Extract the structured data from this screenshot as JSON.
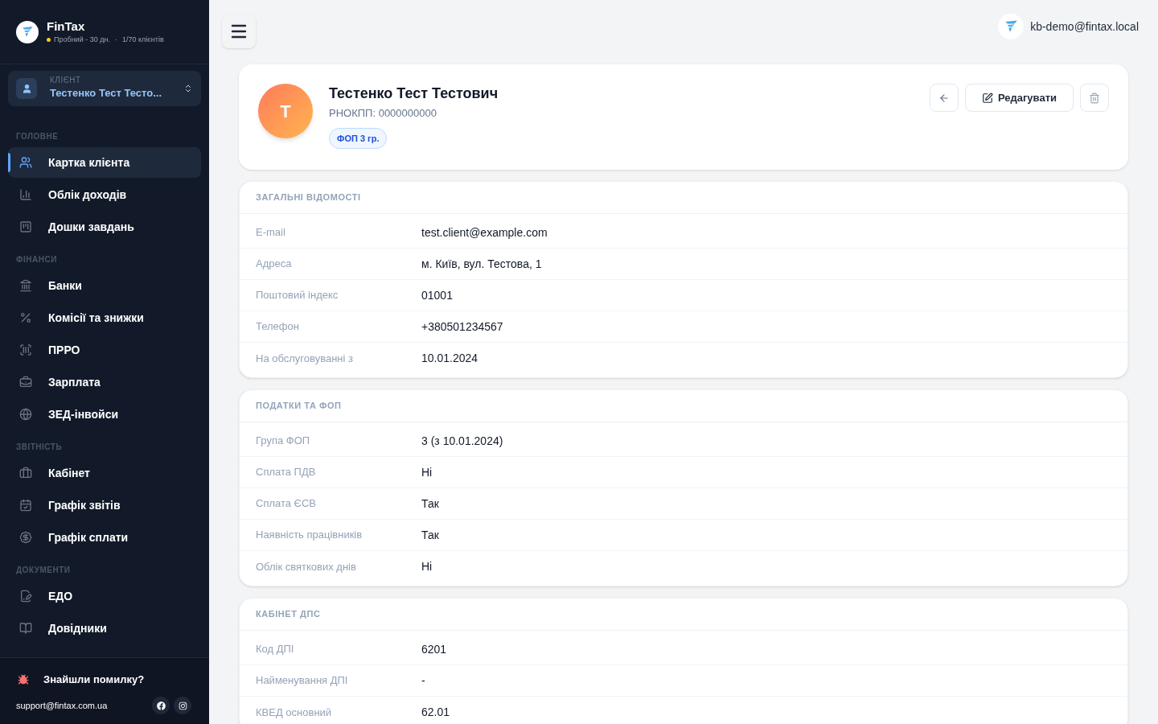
{
  "brand": {
    "name": "FinTax",
    "plan": "Пробний - 30 дн.",
    "separator": "·",
    "clients": "1/70 клієнтів"
  },
  "client_picker": {
    "label": "КЛІЄНТ",
    "value": "Тестенко Тест Тесто..."
  },
  "nav": [
    {
      "title": "ГОЛОВНЕ",
      "items": [
        {
          "label": "Картка клієнта",
          "selected": true
        },
        {
          "label": "Облік доходів",
          "selected": false
        },
        {
          "label": "Дошки завдань",
          "selected": false
        }
      ]
    },
    {
      "title": "ФІНАНСИ",
      "items": [
        {
          "label": "Банки",
          "selected": false
        },
        {
          "label": "Комісії та знижки",
          "selected": false
        },
        {
          "label": "ПРРО",
          "selected": false
        },
        {
          "label": "Зарплата",
          "selected": false
        },
        {
          "label": "ЗЕД-інвойси",
          "selected": false
        }
      ]
    },
    {
      "title": "ЗВІТНІСТЬ",
      "items": [
        {
          "label": "Кабінет",
          "selected": false
        },
        {
          "label": "Графік звітів",
          "selected": false
        },
        {
          "label": "Графік сплати",
          "selected": false
        }
      ]
    },
    {
      "title": "ДОКУМЕНТИ",
      "items": [
        {
          "label": "ЕДО",
          "selected": false
        },
        {
          "label": "Довідники",
          "selected": false
        }
      ]
    }
  ],
  "footer": {
    "bug_report": "Знайшли помилку?",
    "email": "support@fintax.com.ua"
  },
  "user": {
    "email": "kb-demo@fintax.local"
  },
  "profile": {
    "initial": "Т",
    "name": "Тестенко Тест Тестович",
    "tax_id": "РНОКПП: 0000000000",
    "badge": "ФОП 3 гр.",
    "edit": "Редагувати"
  },
  "sections": [
    {
      "title": "ЗАГАЛЬНІ ВІДОМОСТІ",
      "rows": [
        {
          "label": "E-mail",
          "value": "test.client@example.com"
        },
        {
          "label": "Адреса",
          "value": "м. Київ, вул. Тестова, 1"
        },
        {
          "label": "Поштовий індекс",
          "value": "01001"
        },
        {
          "label": "Телефон",
          "value": "+380501234567"
        },
        {
          "label": "На обслуговуванні з",
          "value": "10.01.2024"
        }
      ]
    },
    {
      "title": "ПОДАТКИ ТА ФОП",
      "rows": [
        {
          "label": "Група ФОП",
          "value": "3 (з 10.01.2024)"
        },
        {
          "label": "Сплата ПДВ",
          "value": "Ні"
        },
        {
          "label": "Сплата ЄСВ",
          "value": "Так"
        },
        {
          "label": "Наявність працівників",
          "value": "Так"
        },
        {
          "label": "Облік святкових днів",
          "value": "Ні"
        }
      ]
    },
    {
      "title": "КАБІНЕТ ДПС",
      "rows": [
        {
          "label": "Код ДПІ",
          "value": "6201"
        },
        {
          "label": "Найменування ДПІ",
          "value": "-"
        },
        {
          "label": "КВЕД основний",
          "value": "62.01"
        }
      ]
    }
  ]
}
